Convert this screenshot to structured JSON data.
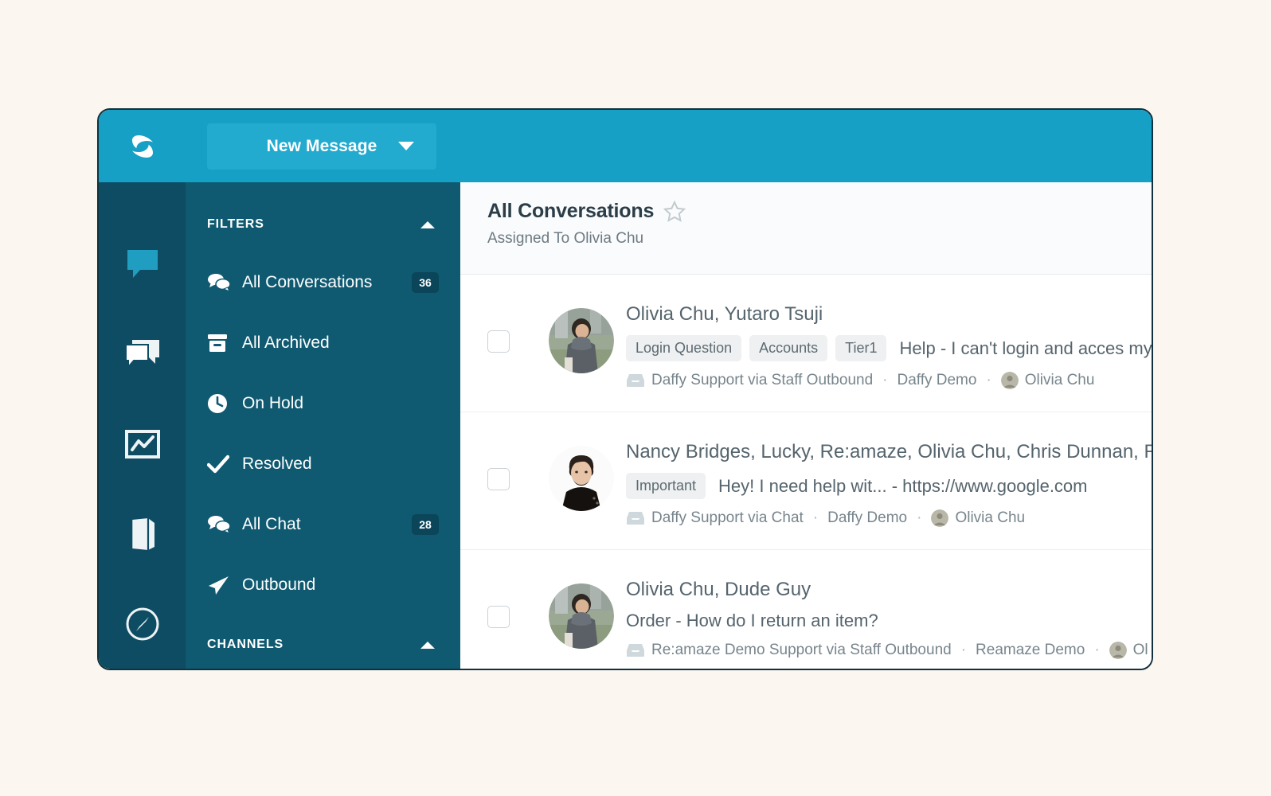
{
  "app": {
    "logo_name": "reamaze-leaf-logo",
    "topbar_color": "#16a0c6",
    "rail_color": "#0d4c63",
    "filters_color": "#0f5a71",
    "new_message_label": "New Message"
  },
  "rail": {
    "items": [
      {
        "name": "conversations-icon",
        "active": true
      },
      {
        "name": "chat-icon",
        "active": false
      },
      {
        "name": "reports-icon",
        "active": false
      },
      {
        "name": "knowledge-base-icon",
        "active": false
      },
      {
        "name": "compass-icon",
        "active": false
      }
    ]
  },
  "sidebar": {
    "filters_heading": "FILTERS",
    "channels_heading": "CHANNELS",
    "filters": [
      {
        "label": "All Conversations",
        "icon": "conversations-bubbles-icon",
        "badge": "36"
      },
      {
        "label": "All Archived",
        "icon": "archive-box-icon",
        "badge": ""
      },
      {
        "label": "On Hold",
        "icon": "clock-icon",
        "badge": ""
      },
      {
        "label": "Resolved",
        "icon": "check-icon",
        "badge": ""
      },
      {
        "label": "All Chat",
        "icon": "conversations-bubbles-icon",
        "badge": "28"
      },
      {
        "label": "Outbound",
        "icon": "paper-plane-icon",
        "badge": ""
      }
    ]
  },
  "header": {
    "title": "All Conversations",
    "star_icon": "star-outline-icon",
    "subtitle": "Assigned To Olivia Chu"
  },
  "conversations": [
    {
      "names": "Olivia Chu, Yutaro Tsuji",
      "tags": [
        "Login Question",
        "Accounts",
        "Tier1"
      ],
      "subject": "Help - I can't login and acces my",
      "channel": "Daffy Support via Staff Outbound",
      "brand": "Daffy Demo",
      "assignee": "Olivia Chu",
      "avatar": "woman-outdoors-avatar"
    },
    {
      "names": "Nancy Bridges, Lucky, Re:amaze, Olivia Chu, Chris Dunnan, R",
      "tags": [
        "Important"
      ],
      "subject": "Hey! I need help wit... - https://www.google.com",
      "channel": "Daffy Support via Chat",
      "brand": "Daffy Demo",
      "assignee": "Olivia Chu",
      "avatar": "young-man-avatar"
    },
    {
      "names": "Olivia Chu, Dude Guy",
      "tags": [],
      "subject": "Order - How do I return an item?",
      "channel": "Re:amaze Demo Support via Staff Outbound",
      "brand": "Reamaze Demo",
      "assignee": "Ol",
      "avatar": "woman-outdoors-avatar"
    }
  ]
}
